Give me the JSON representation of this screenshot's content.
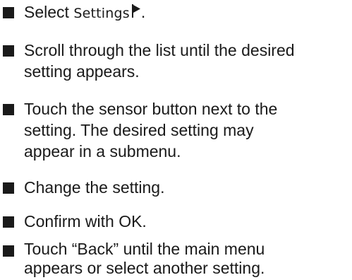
{
  "steps": [
    {
      "prefix": "Select ",
      "ui_name": "Settings",
      "suffix": ".",
      "icon": "flag-icon"
    },
    {
      "lines": [
        "Scroll through the list until the desired",
        "setting appears."
      ]
    },
    {
      "lines": [
        "Touch the sensor button next to the",
        "setting. The desired setting may",
        "appear in a submenu."
      ]
    },
    {
      "lines": [
        "Change the setting."
      ]
    },
    {
      "lines": [
        "Confirm with OK."
      ]
    },
    {
      "lines": [
        "Touch “Back” until the main menu",
        "appears or select another setting."
      ]
    }
  ]
}
